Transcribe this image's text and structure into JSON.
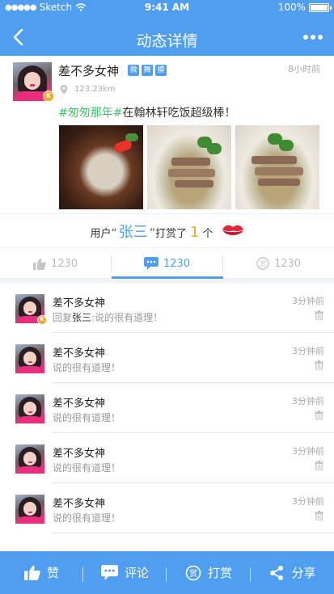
{
  "status_bar": {
    "carrier": "Sketch",
    "time": "9:41 AM",
    "battery": "100%"
  },
  "nav": {
    "title": "动态详情"
  },
  "post": {
    "author": "差不多女神",
    "badge": "K",
    "tags": [
      "微",
      "舞",
      "模"
    ],
    "time": "8小时前",
    "distance": "123.23km",
    "topic": "#匆匆那年#",
    "text": "在翰林轩吃饭超级棒！"
  },
  "reward": {
    "prefix": "用户",
    "open_quote": "“",
    "user": "张三",
    "close_quote": "”",
    "action": "打赏了",
    "count": "1",
    "unit": "个"
  },
  "tabs": [
    {
      "icon": "thumbs-up-icon",
      "count": "1230"
    },
    {
      "icon": "comment-icon",
      "count": "1230"
    },
    {
      "icon": "reward-coin-icon",
      "count": "1230"
    }
  ],
  "comments": [
    {
      "name": "差不多女神",
      "time": "3分钟前",
      "reply_prefix": "回复",
      "reply_to": "张三",
      "text": ":说的很有道理！",
      "badge": "K"
    },
    {
      "name": "差不多女神",
      "time": "3分钟前",
      "text": "说的很有道理！"
    },
    {
      "name": "差不多女神",
      "time": "3分钟前",
      "text": "说的很有道理！"
    },
    {
      "name": "差不多女神",
      "time": "3分钟前",
      "text": "说的很有道理！"
    },
    {
      "name": "差不多女神",
      "time": "3分钟前",
      "text": "说的很有道理！"
    }
  ],
  "footer": {
    "like": "赞",
    "comment": "评论",
    "reward": "打赏",
    "reward_icon_text": "赏",
    "share": "分享"
  },
  "colors": {
    "primary": "#4f9ef0",
    "topic": "#3ec46d",
    "count_accent": "#f6a623",
    "lips": "#e2243c"
  }
}
